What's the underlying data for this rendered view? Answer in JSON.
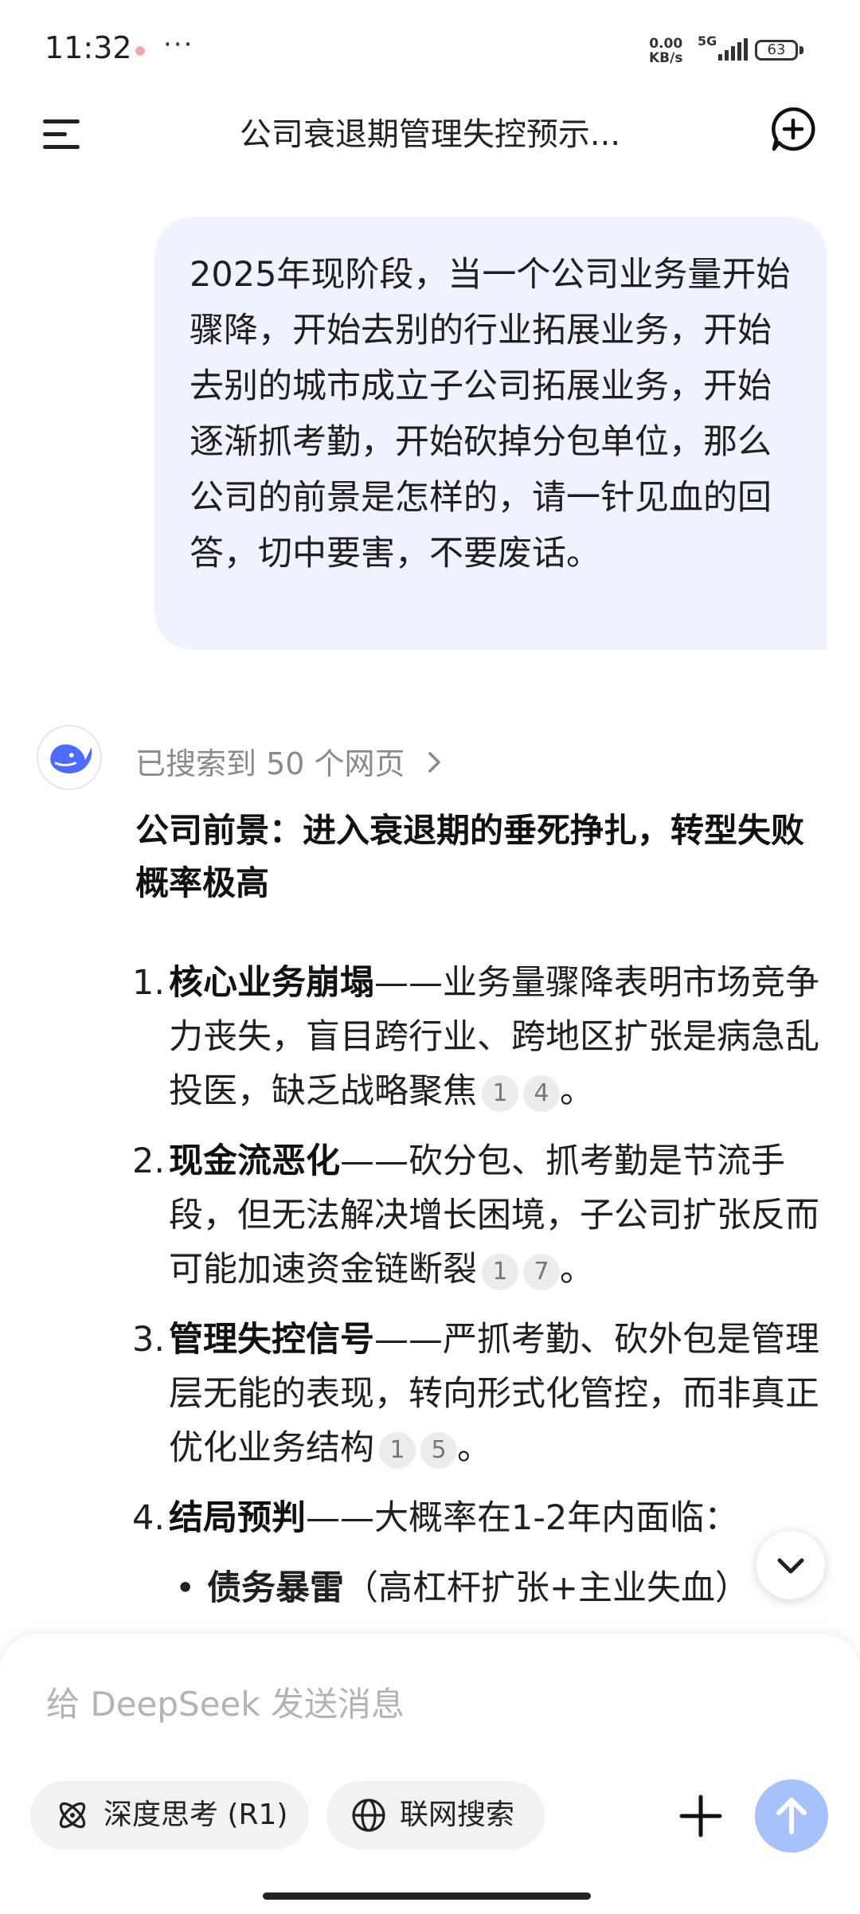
{
  "status": {
    "time": "11:32",
    "more": "···",
    "net_speed_value": "0.00",
    "net_speed_unit": "KB/s",
    "network": "5G",
    "battery": "63"
  },
  "header": {
    "title": "公司衰退期管理失控预示..."
  },
  "user_message": "2025年现阶段，当一个公司业务量开始骤降，开始去别的行业拓展业务，开始去别的城市成立子公司拓展业务，开始逐渐抓考勤，开始砍掉分包单位，那么公司的前景是怎样的，请一针见血的回答，切中要害，不要废话。",
  "response": {
    "searched": "已搜索到 50 个网页",
    "title": "公司前景：进入衰退期的垂死挣扎，转型失败概率极高",
    "items": [
      {
        "num": "1.",
        "bold": "核心业务崩塌",
        "text": "——业务量骤降表明市场竞争力丧失，盲目跨行业、跨地区扩张是病急乱投医，缺乏战略聚焦",
        "cites": [
          "1",
          "4"
        ],
        "end": "。"
      },
      {
        "num": "2.",
        "bold": "现金流恶化",
        "text": "——砍分包、抓考勤是节流手段，但无法解决增长困境，子公司扩张反而可能加速资金链断裂",
        "cites": [
          "1",
          "7"
        ],
        "end": "。"
      },
      {
        "num": "3.",
        "bold": "管理失控信号",
        "text": "——严抓考勤、砍外包是管理层无能的表现，转向形式化管控，而非真正优化业务结构",
        "cites": [
          "1",
          "5"
        ],
        "end": "。"
      },
      {
        "num": "4.",
        "bold": "结局预判",
        "text": "——大概率在1-2年内面临：",
        "cites": [],
        "end": ""
      }
    ],
    "bullet": {
      "bold": "债务暴雷",
      "text": "（高杠杆扩张+主业失血）"
    }
  },
  "composer": {
    "placeholder": "给 DeepSeek 发送消息",
    "deep_think": "深度思考 (R1)",
    "web_search": "联网搜索"
  },
  "colors": {
    "bubble": "#eef3fe",
    "send": "#a7c1fb",
    "accent": "#4d6bfe"
  }
}
